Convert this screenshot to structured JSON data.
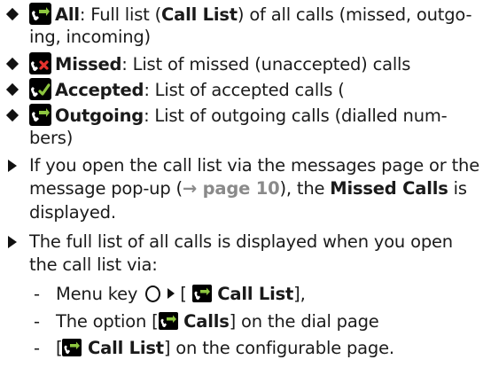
{
  "bullets": [
    {
      "title": "All",
      "text_before": ": Full list (",
      "bold_mid": "Call List",
      "text_after": ") of all calls (missed, outgo-",
      "line2": "ing, incoming)",
      "icon": "call-list-all-icon"
    },
    {
      "title": "Missed",
      "text": ": List of missed (unaccepted) calls",
      "icon": "missed-call-icon"
    },
    {
      "title": "Accepted",
      "text": ": List of accepted calls (",
      "icon": "accepted-call-icon"
    },
    {
      "title": "Outgoing",
      "text": ": List of outgoing calls (dialled num-",
      "line2": "bers)",
      "icon": "outgoing-call-icon"
    }
  ],
  "para1": {
    "line1": "If you open the call list via the messages page or the",
    "line2_before": "message pop-up (",
    "arrow": "→",
    "page_ref": "page 10",
    "line2_close": "), the ",
    "line2_bold": "Missed Calls",
    "line2_after": " is",
    "line3": "displayed."
  },
  "para2": {
    "line1": "The full list of all calls is displayed when you open",
    "line2": "the call list via:"
  },
  "list_items": [
    {
      "before": "Menu key ",
      "bracket_open": "[",
      "bold": " Call List",
      "bracket_close": "],"
    },
    {
      "before": "The option ",
      "bracket_open": "[",
      "bold": " Calls",
      "bracket_close": "]",
      "after": " on the dial page"
    },
    {
      "before": "",
      "bracket_open": "[",
      "bold": " Call List",
      "bracket_close": "]",
      "after": " on the configurable page."
    }
  ],
  "dash_char": "-",
  "colors": {
    "icon_bg": "#000000",
    "icon_fg": "#ffffff",
    "accent_green": "#8dc63f",
    "missed_red": "#e5322d",
    "page_ref": "#8a8a8a"
  }
}
